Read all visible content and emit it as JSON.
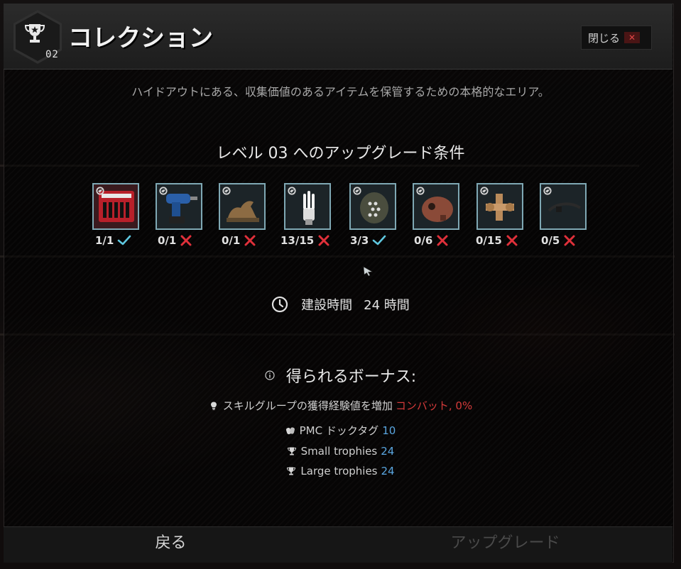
{
  "header": {
    "title": "コレクション",
    "level": "02",
    "close_label": "閉じる",
    "close_x": "✕"
  },
  "description": "ハイドアウトにある、収集価値のあるアイテムを保管するための本格的なエリア。",
  "requirements": {
    "heading": "レベル 03 へのアップグレード条件",
    "items": [
      {
        "name": "screwdriver-set-icon",
        "count": "1/1",
        "met": true
      },
      {
        "name": "power-drill-icon",
        "count": "0/1",
        "met": false
      },
      {
        "name": "horse-figurine-icon",
        "count": "0/1",
        "met": false
      },
      {
        "name": "energy-saving-lamp-icon",
        "count": "13/15",
        "met": false
      },
      {
        "name": "led-bulb-icon",
        "count": "3/3",
        "met": true
      },
      {
        "name": "rooster-figurine-icon",
        "count": "0/6",
        "met": false
      },
      {
        "name": "pipe-fittings-icon",
        "count": "0/15",
        "met": false
      },
      {
        "name": "cable-tie-icon",
        "count": "0/5",
        "met": false
      }
    ]
  },
  "build": {
    "label": "建設時間",
    "value": "24 時間"
  },
  "bonuses": {
    "heading": "得られるボーナス:",
    "lines": [
      {
        "icon": "lightbulb-icon",
        "text": "スキルグループの獲得経験値を増加",
        "value": "コンバット, 0%",
        "value_color": "#d43a3a"
      },
      {
        "icon": "dogtag-icon",
        "text": "PMC ドックタグ",
        "value": "10",
        "value_color": "#5aa6e0"
      },
      {
        "icon": "trophy-icon",
        "text": "Small trophies",
        "value": "24",
        "value_color": "#5aa6e0"
      },
      {
        "icon": "trophy-icon",
        "text": "Large trophies",
        "value": "24",
        "value_color": "#5aa6e0"
      }
    ]
  },
  "footer": {
    "back_label": "戻る",
    "upgrade_label": "アップグレード"
  },
  "colors": {
    "ok": "#5fc8e0",
    "fail": "#e0303a",
    "item_border": "#7fa8b4"
  }
}
